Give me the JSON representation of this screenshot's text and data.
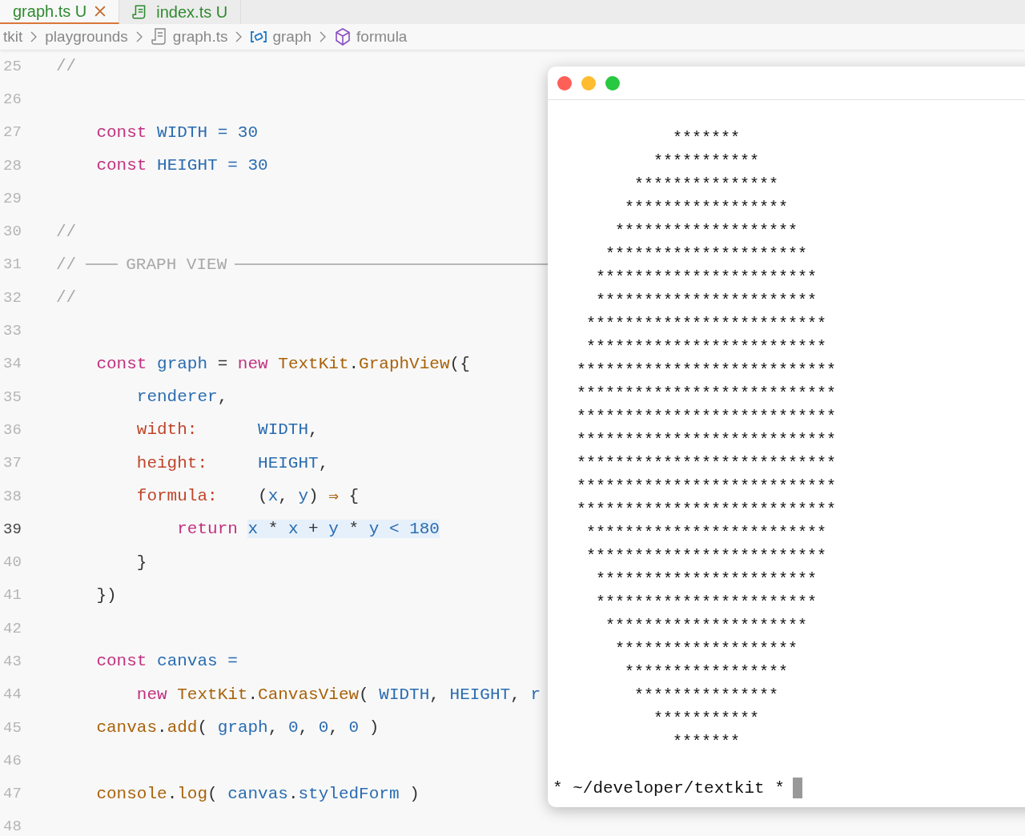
{
  "tabs": [
    {
      "label": "graph.ts",
      "badge": "U",
      "selected": true
    },
    {
      "label": "index.ts",
      "badge": "U",
      "selected": false
    }
  ],
  "breadcrumb": [
    {
      "label": "tkit",
      "kind": "folder"
    },
    {
      "label": "playgrounds",
      "kind": "folder"
    },
    {
      "label": "graph.ts",
      "kind": "file"
    },
    {
      "label": "graph",
      "kind": "variable"
    },
    {
      "label": "formula",
      "kind": "method"
    }
  ],
  "editor": {
    "lines": [
      {
        "number": "25",
        "current": false,
        "tokens": [
          {
            "kind": "comment",
            "text": "//"
          }
        ]
      },
      {
        "number": "26",
        "current": false
      },
      {
        "number": "27",
        "current": false,
        "tokens": [
          {
            "kind": "keyword",
            "text": "    const"
          },
          {
            "kind": "ident",
            "text": " WIDTH = "
          },
          {
            "kind": "number",
            "text": "30"
          }
        ]
      },
      {
        "number": "28",
        "current": false,
        "tokens": [
          {
            "kind": "keyword",
            "text": "    const"
          },
          {
            "kind": "ident",
            "text": " HEIGHT = "
          },
          {
            "kind": "number",
            "text": "30"
          }
        ]
      },
      {
        "number": "29",
        "current": false
      },
      {
        "number": "30",
        "current": false,
        "tokens": [
          {
            "kind": "comment",
            "text": "//"
          }
        ]
      },
      {
        "number": "31",
        "current": false,
        "tokens": [
          {
            "kind": "comment",
            "text": "//"
          },
          {
            "kind": "section",
            "text": "GRAPH VIEW"
          }
        ]
      },
      {
        "number": "32",
        "current": false,
        "tokens": [
          {
            "kind": "comment",
            "text": "//"
          }
        ]
      },
      {
        "number": "33",
        "current": false
      },
      {
        "number": "34",
        "current": false,
        "tokens": [
          {
            "kind": "keyword",
            "text": "    const"
          },
          {
            "kind": "ident",
            "text": " graph"
          },
          {
            "kind": "plain",
            "text": " = "
          },
          {
            "kind": "keyword",
            "text": "new"
          },
          {
            "kind": "func",
            "text": " TextKit"
          },
          {
            "kind": "plain",
            "text": "."
          },
          {
            "kind": "func",
            "text": "GraphView"
          },
          {
            "kind": "plain",
            "text": "({"
          }
        ]
      },
      {
        "number": "35",
        "current": false,
        "tokens": [
          {
            "kind": "ident",
            "text": "        renderer"
          },
          {
            "kind": "plain",
            "text": ","
          }
        ]
      },
      {
        "number": "36",
        "current": false,
        "tokens": [
          {
            "kind": "prop",
            "text": "        width:"
          },
          {
            "kind": "ident",
            "text": "      WIDTH"
          },
          {
            "kind": "plain",
            "text": ","
          }
        ]
      },
      {
        "number": "37",
        "current": false,
        "tokens": [
          {
            "kind": "prop",
            "text": "        height:"
          },
          {
            "kind": "ident",
            "text": "     HEIGHT"
          },
          {
            "kind": "plain",
            "text": ","
          }
        ]
      },
      {
        "number": "38",
        "current": false,
        "tokens": [
          {
            "kind": "prop",
            "text": "        formula:"
          },
          {
            "kind": "plain",
            "text": "    ("
          },
          {
            "kind": "ident",
            "text": "x"
          },
          {
            "kind": "plain",
            "text": ", "
          },
          {
            "kind": "ident",
            "text": "y"
          },
          {
            "kind": "plain",
            "text": ") "
          },
          {
            "kind": "func",
            "text": "⇒"
          },
          {
            "kind": "plain",
            "text": " {"
          }
        ]
      },
      {
        "number": "39",
        "current": true,
        "tokens": [
          {
            "kind": "keyword",
            "text": "            return "
          },
          {
            "kind": "selection",
            "parts": [
              {
                "kind": "ident",
                "text": "x"
              },
              {
                "kind": "plain",
                "text": " * "
              },
              {
                "kind": "ident",
                "text": "x"
              },
              {
                "kind": "plain",
                "text": " + "
              },
              {
                "kind": "ident",
                "text": "y"
              },
              {
                "kind": "plain",
                "text": " * "
              },
              {
                "kind": "ident",
                "text": "y"
              },
              {
                "kind": "ident",
                "text": " < "
              },
              {
                "kind": "number",
                "text": "180"
              }
            ]
          }
        ]
      },
      {
        "number": "40",
        "current": false,
        "tokens": [
          {
            "kind": "plain",
            "text": "        }"
          }
        ]
      },
      {
        "number": "41",
        "current": false,
        "tokens": [
          {
            "kind": "plain",
            "text": "    })"
          }
        ]
      },
      {
        "number": "42",
        "current": false
      },
      {
        "number": "43",
        "current": false,
        "tokens": [
          {
            "kind": "keyword",
            "text": "    const"
          },
          {
            "kind": "ident",
            "text": " canvas ="
          }
        ]
      },
      {
        "number": "44",
        "current": false,
        "tokens": [
          {
            "kind": "keyword",
            "text": "        new"
          },
          {
            "kind": "func",
            "text": " TextKit"
          },
          {
            "kind": "plain",
            "text": "."
          },
          {
            "kind": "func",
            "text": "CanvasView"
          },
          {
            "kind": "plain",
            "text": "( "
          },
          {
            "kind": "ident",
            "text": "WIDTH"
          },
          {
            "kind": "plain",
            "text": ", "
          },
          {
            "kind": "ident",
            "text": "HEIGHT"
          },
          {
            "kind": "plain",
            "text": ", "
          },
          {
            "kind": "ident",
            "text": "r"
          }
        ]
      },
      {
        "number": "45",
        "current": false,
        "tokens": [
          {
            "kind": "func",
            "text": "    canvas"
          },
          {
            "kind": "plain",
            "text": "."
          },
          {
            "kind": "func",
            "text": "add"
          },
          {
            "kind": "plain",
            "text": "( "
          },
          {
            "kind": "ident",
            "text": "graph"
          },
          {
            "kind": "plain",
            "text": ", "
          },
          {
            "kind": "number",
            "text": "0"
          },
          {
            "kind": "plain",
            "text": ", "
          },
          {
            "kind": "number",
            "text": "0"
          },
          {
            "kind": "plain",
            "text": ", "
          },
          {
            "kind": "number",
            "text": "0"
          },
          {
            "kind": "plain",
            "text": " )"
          }
        ]
      },
      {
        "number": "46",
        "current": false
      },
      {
        "number": "47",
        "current": false,
        "tokens": [
          {
            "kind": "func",
            "text": "    console"
          },
          {
            "kind": "plain",
            "text": "."
          },
          {
            "kind": "func",
            "text": "log"
          },
          {
            "kind": "plain",
            "text": "( "
          },
          {
            "kind": "ident",
            "text": "canvas"
          },
          {
            "kind": "plain",
            "text": "."
          },
          {
            "kind": "ident",
            "text": "styledForm"
          },
          {
            "kind": "plain",
            "text": " )"
          }
        ]
      },
      {
        "number": "48",
        "current": false
      }
    ]
  },
  "terminal": {
    "output": "*******\n***********\n***************\n*****************\n*******************\n*********************\n***********************\n***********************\n*************************\n*************************\n***************************\n***************************\n***************************\n***************************\n***************************\n***************************\n***************************\n*************************\n*************************\n***********************\n***********************\n*********************\n*******************\n*****************\n***************\n***********\n*******",
    "prompt": "* ~/developer/textkit *"
  }
}
